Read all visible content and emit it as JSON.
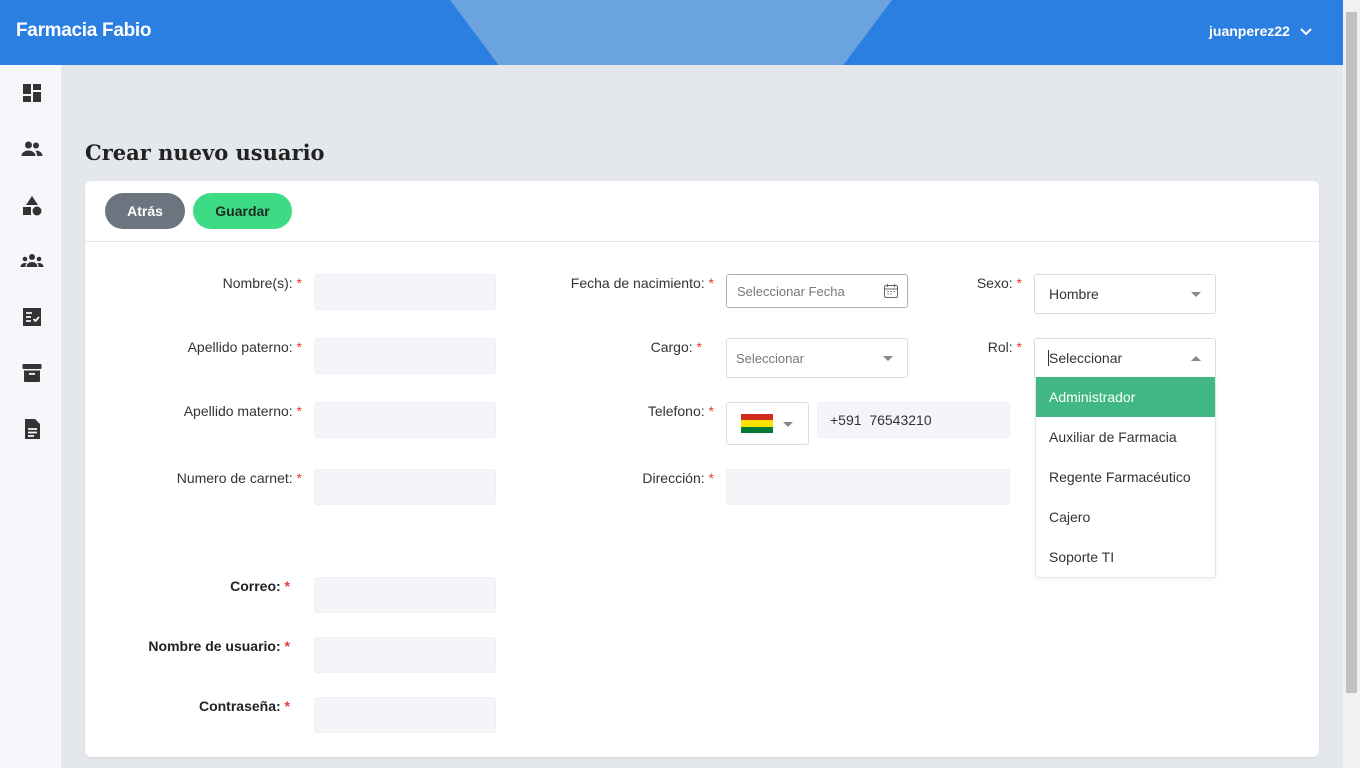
{
  "header": {
    "brand": "Farmacia Fabio",
    "username": "juanperez22"
  },
  "sidebar": {
    "items": [
      {
        "icon": "dashboard-icon"
      },
      {
        "icon": "users-icon"
      },
      {
        "icon": "shapes-icon"
      },
      {
        "icon": "groups-icon"
      },
      {
        "icon": "checklist-icon"
      },
      {
        "icon": "archive-icon"
      },
      {
        "icon": "document-icon"
      }
    ]
  },
  "page": {
    "title": "Crear nuevo usuario"
  },
  "toolbar": {
    "back_label": "Atrás",
    "save_label": "Guardar"
  },
  "form": {
    "nombres_label": "Nombre(s):",
    "apellido_paterno_label": "Apellido paterno:",
    "apellido_materno_label": "Apellido materno:",
    "carnet_label": "Numero de carnet:",
    "correo_label": "Correo:",
    "usuario_label": "Nombre de usuario:",
    "password_label": "Contraseña:",
    "fecha_label": "Fecha de nacimiento:",
    "fecha_placeholder": "Seleccionar Fecha",
    "cargo_label": "Cargo:",
    "cargo_placeholder": "Seleccionar",
    "telefono_label": "Telefono:",
    "telefono_value": "+591  76543210",
    "direccion_label": "Dirección:",
    "sexo_label": "Sexo:",
    "sexo_value": "Hombre",
    "rol_label": "Rol:",
    "rol_placeholder": "Seleccionar",
    "required_mark": "*"
  },
  "rol_options": [
    "Administrador",
    "Auxiliar de Farmacia",
    "Regente Farmacéutico",
    "Cajero",
    "Soporte TI"
  ],
  "colors": {
    "header": "#2b7fe0",
    "save": "#3ddc84",
    "back": "#6c7480",
    "selected_option": "#41b883",
    "required": "#e23b3b"
  }
}
